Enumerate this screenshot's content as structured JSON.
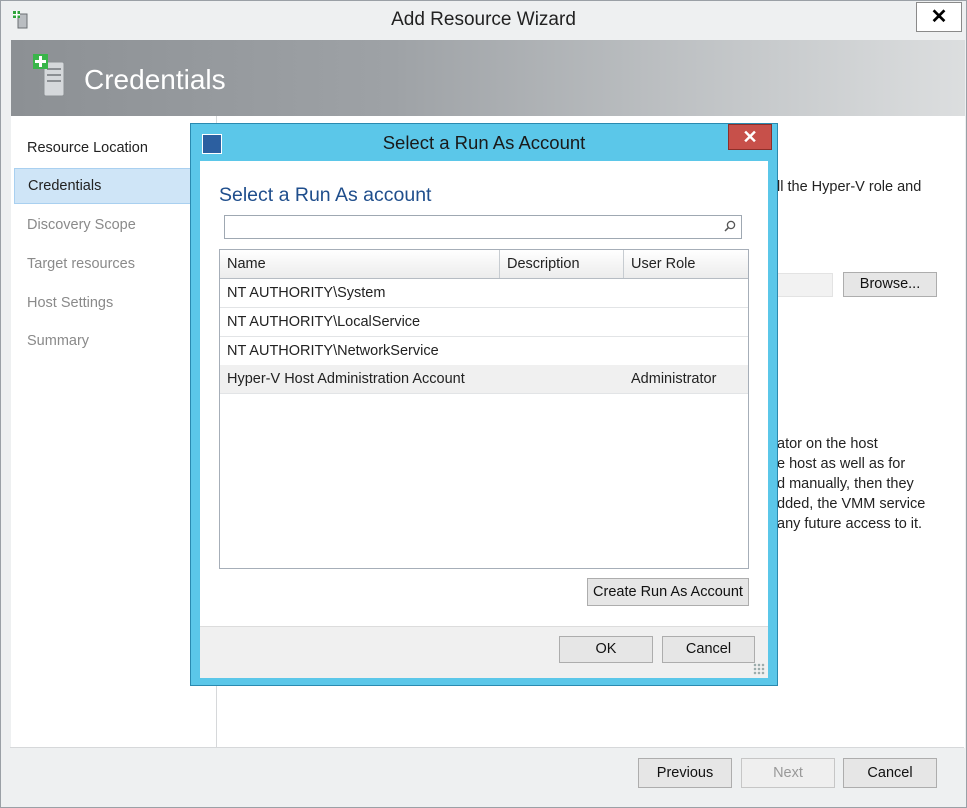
{
  "window": {
    "title": "Add Resource Wizard",
    "close_glyph": "✕"
  },
  "banner": {
    "title": "Credentials",
    "icon": "server-add-icon"
  },
  "nav": {
    "items": [
      {
        "label": "Resource Location",
        "state": "done"
      },
      {
        "label": "Credentials",
        "state": "active"
      },
      {
        "label": "Discovery Scope",
        "state": "pending"
      },
      {
        "label": "Target resources",
        "state": "pending"
      },
      {
        "label": "Host Settings",
        "state": "pending"
      },
      {
        "label": "Summary",
        "state": "pending"
      }
    ]
  },
  "content": {
    "line_top": "ll the Hyper-V role and",
    "browse_label": "Browse...",
    "para": [
      "ator on the host",
      "e host as well as for",
      "d manually, then they",
      "dded, the VMM service",
      "any future access to it."
    ]
  },
  "footer": {
    "previous_label": "Previous",
    "next_label": "Next",
    "cancel_label": "Cancel"
  },
  "dialog": {
    "title": "Select a Run As Account",
    "close_glyph": "✕",
    "heading": "Select a Run As account",
    "search": {
      "value": "",
      "placeholder": ""
    },
    "columns": [
      "Name",
      "Description",
      "User Role"
    ],
    "rows": [
      {
        "name": "NT AUTHORITY\\System",
        "description": "",
        "role": ""
      },
      {
        "name": "NT AUTHORITY\\LocalService",
        "description": "",
        "role": ""
      },
      {
        "name": "NT AUTHORITY\\NetworkService",
        "description": "",
        "role": ""
      },
      {
        "name": "Hyper-V Host Administration Account",
        "description": "",
        "role": "Administrator"
      }
    ],
    "create_label": "Create Run As Account",
    "ok_label": "OK",
    "cancel_label": "Cancel"
  },
  "colors": {
    "dialog_frame": "#5bc7e9",
    "dialog_close": "#c7504a",
    "heading": "#1f4e8c",
    "nav_active": "#cfe5f7"
  }
}
